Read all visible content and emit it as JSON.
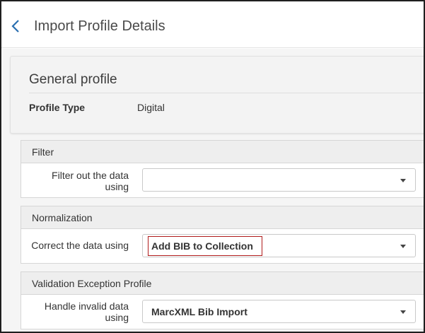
{
  "header": {
    "title": "Import Profile Details"
  },
  "general": {
    "title": "General profile",
    "profile_type_label": "Profile Type",
    "profile_type_value": "Digital"
  },
  "sections": [
    {
      "title": "Filter",
      "label_line1": "Filter out the data",
      "label_line2": "using",
      "value": ""
    },
    {
      "title": "Normalization",
      "label_line1": "Correct the data using",
      "label_line2": "",
      "value": "Add BIB to Collection"
    },
    {
      "title": "Validation Exception Profile",
      "label_line1": "Handle invalid data",
      "label_line2": "using",
      "value": "MarcXML Bib Import"
    }
  ],
  "colors": {
    "back_arrow": "#2a6fb0",
    "highlight_border": "#b01b1b"
  },
  "icons": {
    "back": "chevron-left-icon",
    "dropdown": "caret-down-icon"
  }
}
